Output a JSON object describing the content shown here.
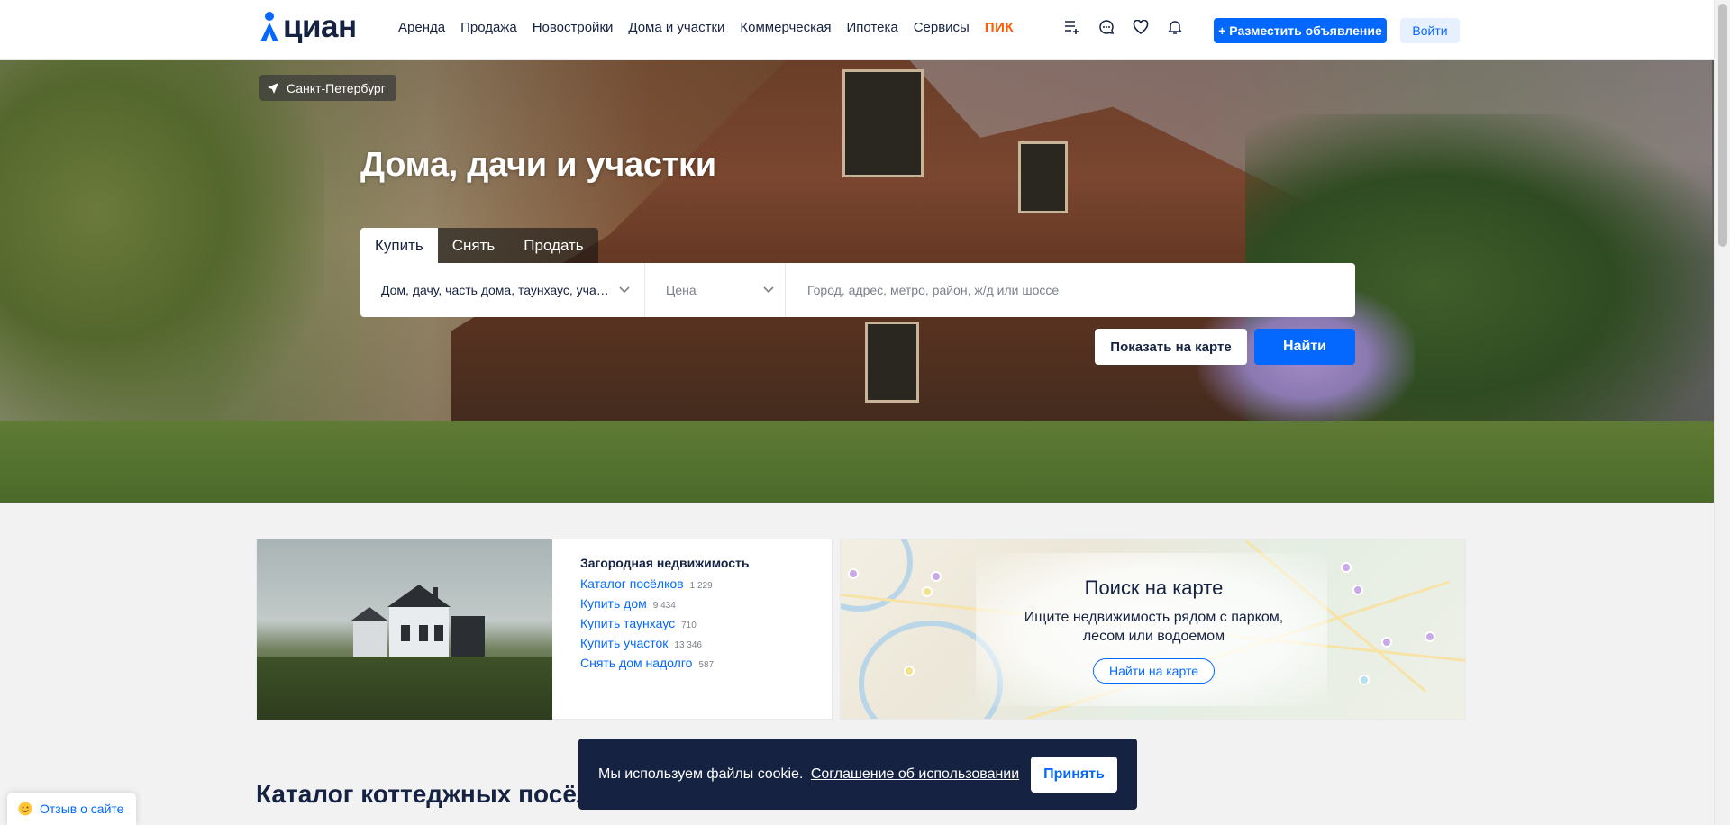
{
  "header": {
    "logo_text": "циан",
    "nav": [
      "Аренда",
      "Продажа",
      "Новостройки",
      "Дома и участки",
      "Коммерческая",
      "Ипотека",
      "Сервисы",
      "ПИК"
    ],
    "post_button": "+ Разместить объявление",
    "login_button": "Войти",
    "icons": [
      "compare-list-icon",
      "chat-icon",
      "heart-icon",
      "bell-icon"
    ]
  },
  "hero": {
    "city": "Санкт-Петербург",
    "title": "Дома, дачи и участки",
    "tabs": [
      "Купить",
      "Снять",
      "Продать"
    ],
    "active_tab": "Купить",
    "type_select": "Дом, дачу, часть дома, таунхаус, участок",
    "price_placeholder": "Цена",
    "address_placeholder": "Город, адрес, метро, район, ж/д или шоссе",
    "map_button": "Показать на карте",
    "find_button": "Найти"
  },
  "country": {
    "title": "Загородная недвижимость",
    "links": [
      {
        "label": "Каталог посёлков",
        "count": "1 229"
      },
      {
        "label": "Купить дом",
        "count": "9 434"
      },
      {
        "label": "Купить таунхаус",
        "count": "710"
      },
      {
        "label": "Купить участок",
        "count": "13 346"
      },
      {
        "label": "Снять дом надолго",
        "count": "587"
      }
    ]
  },
  "map_card": {
    "title": "Поиск на карте",
    "desc_line1": "Ищите недвижимость рядом с парком,",
    "desc_line2": "лесом или водоемом",
    "button": "Найти на карте"
  },
  "catalog_title": "Каталог коттеджных посёлков",
  "cookie": {
    "text": "Мы используем файлы cookie.",
    "link": "Соглашение об использовании",
    "accept": "Принять"
  },
  "feedback": "Отзыв о сайте",
  "colors": {
    "brand_blue": "#0468ff",
    "dark_navy": "#152242",
    "pik_orange": "#ff5a00"
  }
}
